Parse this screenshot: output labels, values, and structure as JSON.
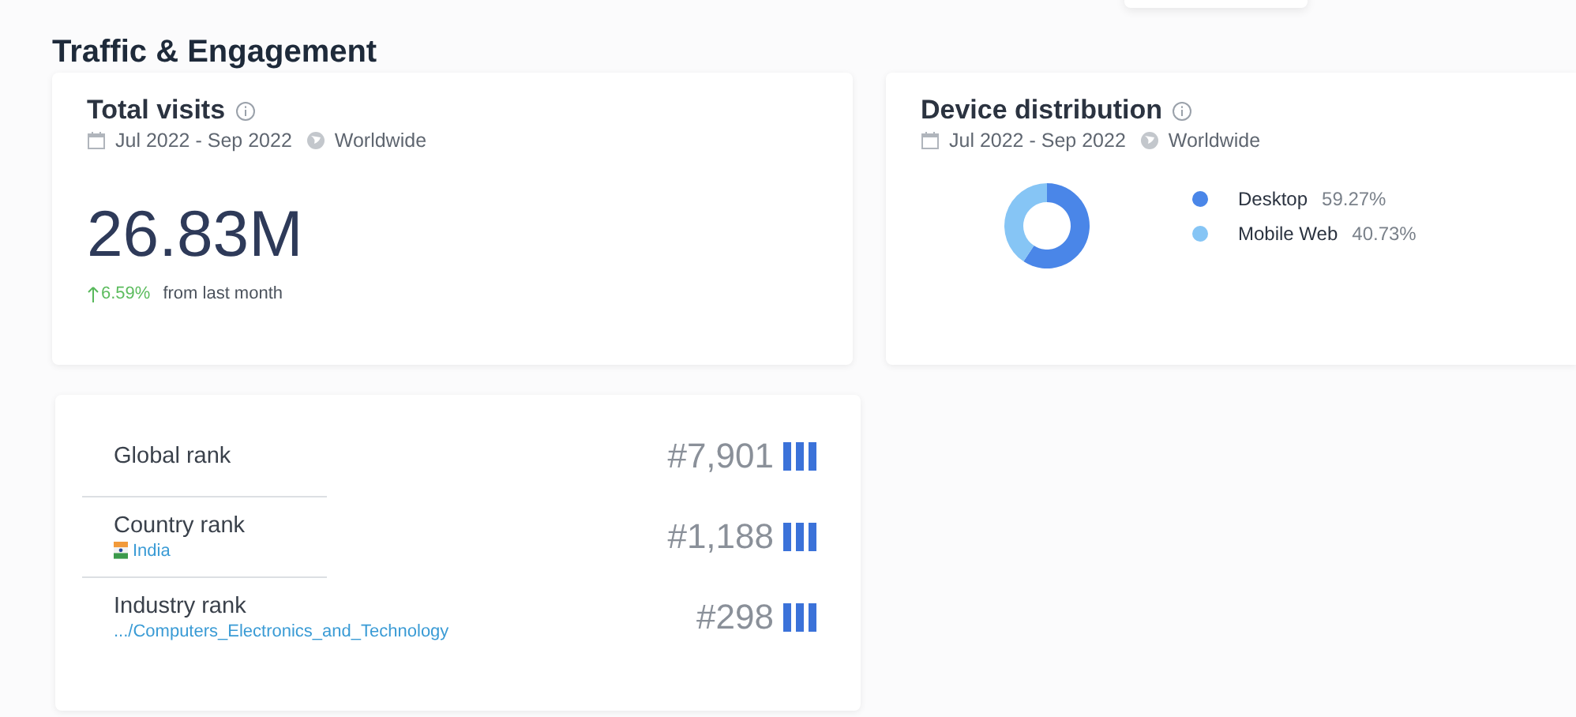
{
  "page_title": "Traffic & Engagement",
  "total_visits": {
    "title": "Total visits",
    "period": "Jul 2022 - Sep 2022",
    "region": "Worldwide",
    "value": "26.83M",
    "change": "6.59%",
    "change_note": "from last month"
  },
  "device_distribution": {
    "title": "Device distribution",
    "period": "Jul 2022 - Sep 2022",
    "region": "Worldwide",
    "legend": [
      {
        "label": "Desktop",
        "value": "59.27%",
        "color": "#4a86e8"
      },
      {
        "label": "Mobile Web",
        "value": "40.73%",
        "color": "#86c5f5"
      }
    ]
  },
  "ranks": [
    {
      "kind": "plain",
      "label": "Global rank",
      "value": "#7,901"
    },
    {
      "kind": "country",
      "label": "Country rank",
      "sublabel": "India",
      "value": "#1,188"
    },
    {
      "kind": "category",
      "label": "Industry rank",
      "sublabel": ".../Computers_Electronics_and_Technology",
      "value": "#298"
    }
  ]
}
